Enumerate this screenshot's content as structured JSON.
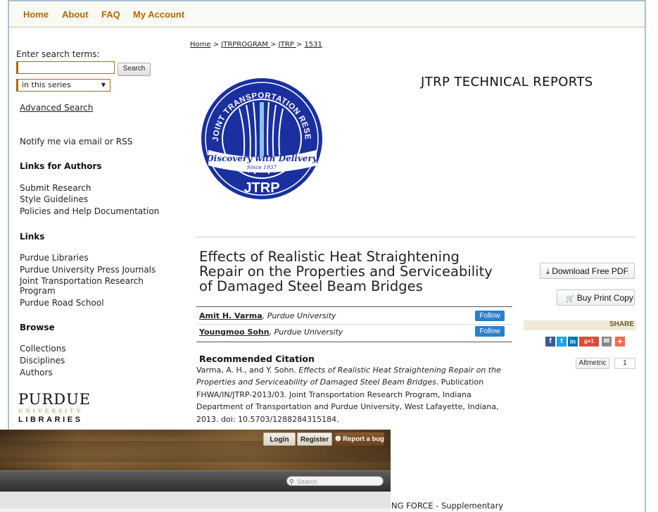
{
  "topnav": {
    "home": "Home",
    "about": "About",
    "faq": "FAQ",
    "account": "My Account"
  },
  "sidebar": {
    "search_label": "Enter search terms:",
    "search_value": "",
    "search_button": "Search",
    "scope_value": "in this series",
    "advanced_search": "Advanced Search",
    "notify": "Notify me via email or RSS",
    "authors_heading": "Links for Authors",
    "author_links": [
      "Submit Research",
      "Style Guidelines",
      "Policies and Help Documentation"
    ],
    "links_heading": "Links",
    "links": [
      "Purdue Libraries",
      "Purdue University Press Journals",
      "Joint Transportation Research",
      "Program",
      "Purdue Road School"
    ],
    "browse_heading": "Browse",
    "browse_links": [
      "Collections",
      "Disciplines",
      "Authors"
    ],
    "logo": {
      "word": "PURDUE",
      "univ": "UNIVERSITY",
      "libs": "LIBRARIES"
    }
  },
  "breadcrumb": {
    "home": "Home",
    "sep": " > ",
    "program": "JTRPROGRAM ",
    "series": "JTRP ",
    "id": "1531"
  },
  "series_title": "JTRP TECHNICAL REPORTS",
  "jtrp_logo": {
    "ring_text": "JOINT TRANSPORTATION RESEARCH PROGRAM",
    "tagline": "Discovery with Delivery",
    "since": "Since 1937",
    "acronym": "JTRP"
  },
  "paper": {
    "title_lines": [
      "Effects of Realistic Heat Straightening",
      "Repair on the Properties and Serviceability",
      "of Damaged Steel Beam Bridges"
    ],
    "authors": [
      {
        "name": "Amit H. Varma",
        "affil": ", Purdue University",
        "follow": "Follow"
      },
      {
        "name": "Youngmoo Sohn",
        "affil": ", Purdue University",
        "follow": "Follow"
      }
    ],
    "citation_heading": "Recommended Citation",
    "citation_prefix": "Varma, A. H., and Y. Sohn. ",
    "citation_title": "Effects of Realistic Heat Straightening Repair on the Properties and Serviceability of Damaged Steel Beam Bridges",
    "citation_suffix": ". Publication FHWA/IN/JTRP-2013/03. Joint Transportation Research Program, Indiana Department of Transportation and Purdue University, West Lafayette, Indiana, 2013. doi: 10.5703/1288284315184."
  },
  "actions": {
    "download": "Download Free PDF",
    "buy": "Buy Print Copy",
    "share": "SHARE",
    "share_icons": [
      {
        "name": "facebook-icon",
        "glyph": "f",
        "color": "#3b5998"
      },
      {
        "name": "twitter-icon",
        "glyph": "t",
        "color": "#1da1f2"
      },
      {
        "name": "linkedin-icon",
        "glyph": "in",
        "color": "#0077b5"
      },
      {
        "name": "googleplus-icon",
        "glyph": "g+1",
        "color": "#dd4b39"
      },
      {
        "name": "email-icon",
        "glyph": "✉",
        "color": "#888888"
      },
      {
        "name": "addthis-icon",
        "glyph": "+",
        "color": "#f8694d"
      }
    ],
    "altmetric": "Altmetric",
    "altmetric_count": "1"
  },
  "overlay": {
    "login": "Login",
    "register": "Register",
    "report_bug": "Report a bug",
    "search_placeholder": "Search"
  },
  "cutoff_text": "NG FORCE - Supplementary"
}
